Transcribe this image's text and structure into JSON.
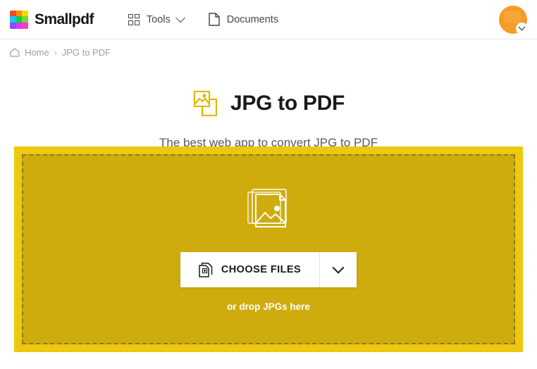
{
  "header": {
    "brand_name": "Smallpdf",
    "logo_colors": [
      "#F5491F",
      "#F98C13",
      "#F7D800",
      "#11C9F5",
      "#10C94A",
      "#7BD62B",
      "#8B4BF5",
      "#D13BF0",
      "#F73BD1"
    ],
    "nav": [
      {
        "label": "Tools",
        "icon": "grid-icon",
        "has_chevron": true
      },
      {
        "label": "Documents",
        "icon": "document-icon",
        "has_chevron": false
      }
    ],
    "avatar": {
      "icon": "avatar-icon",
      "color": "#F89B25",
      "menu_icon": "chevron-down-icon"
    }
  },
  "breadcrumb": {
    "home_icon": "home-icon",
    "home_label": "Home",
    "separator": "›",
    "current_label": "JPG to PDF"
  },
  "page": {
    "tool_icon": "jpg-to-pdf-icon",
    "title": "JPG to PDF",
    "subtitle": "The best web app to convert JPG to PDF",
    "accent_color": "#ECC80E"
  },
  "dropzone": {
    "outer_color": "#ECC80E",
    "inner_color": "#CEAC0E",
    "border_color": "#8C7A22",
    "stack_icon": "image-stack-icon",
    "choose_files": {
      "icon": "document-plus-icon",
      "label": "CHOOSE FILES",
      "dropdown_icon": "chevron-down-icon"
    },
    "drop_hint": "or drop JPGs here"
  }
}
